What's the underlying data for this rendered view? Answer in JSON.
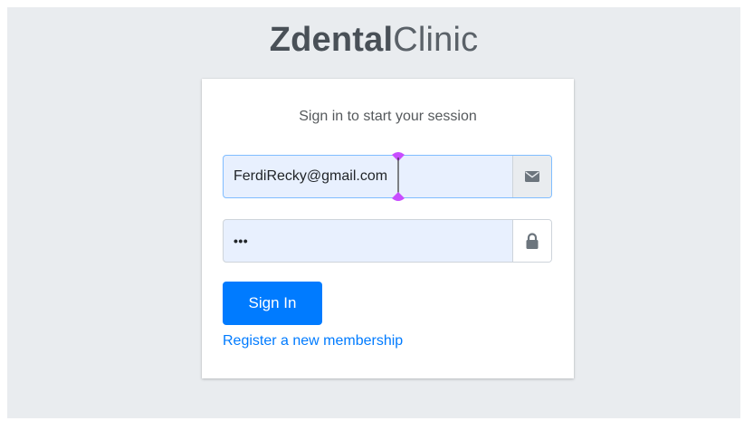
{
  "logo": {
    "bold": "Zdental",
    "light": "Clinic"
  },
  "login": {
    "message": "Sign in to start your session",
    "email": {
      "value": "FerdiRecky@gmail.com",
      "icon": "envelope-icon"
    },
    "password": {
      "value": "•••",
      "icon": "lock-icon"
    },
    "sign_in_label": "Sign In",
    "register_label": "Register a new membership"
  },
  "colors": {
    "primary": "#007bff",
    "background": "#e9ecef",
    "autofill": "#e8f0fe",
    "selection_handle": "#c84dff"
  }
}
